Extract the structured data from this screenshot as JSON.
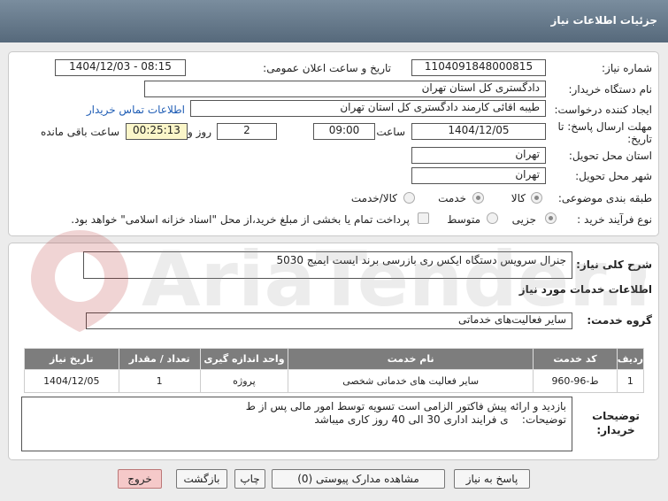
{
  "header": {
    "title": "جزئیات اطلاعات نیاز"
  },
  "form": {
    "need_number_label": "شماره نیاز:",
    "need_number": "1104091848000815",
    "announce_label": "تاریخ و ساعت اعلان عمومی:",
    "announce_value": "1404/12/03 - 08:15",
    "buyer_label": "نام دستگاه خریدار:",
    "buyer": "دادگستری کل استان تهران",
    "creator_label": "ایجاد کننده درخواست:",
    "creator": "طیبه اقائی کارمند دادگستری کل استان تهران",
    "contact_link": "اطلاعات تماس خریدار",
    "deadline_label": "مهلت ارسال پاسخ: تا تاریخ:",
    "deadline_date": "1404/12/05",
    "time_label": "ساعت",
    "deadline_time": "09:00",
    "days_value": "2",
    "days_label": "روز و",
    "remaining_time": "00:25:13",
    "remaining_label": "ساعت باقی مانده",
    "province_label": "استان محل تحویل:",
    "province": "تهران",
    "city_label": "شهر محل تحویل:",
    "city": "تهران",
    "category_label": "طبقه بندی موضوعی:",
    "category_options": [
      "کالا",
      "خدمت",
      "کالا/خدمت"
    ],
    "process_label": "نوع فرآیند خرید :",
    "process_options": [
      "جزیی",
      "متوسط"
    ],
    "payment_note": "پرداخت تمام یا بخشی از مبلغ خرید،از محل \"اسناد خزانه اسلامی\" خواهد بود."
  },
  "description": {
    "label": "شرح کلی نیاز:",
    "value": "جنرال سرویس دستگاه ایکس ری بازرسی برند ایست ایمیج 5030"
  },
  "services": {
    "section_title": "اطلاعات خدمات مورد نیاز",
    "group_label": "گروه خدمت:",
    "group_value": "سایر فعالیت‌های خدماتی",
    "columns": [
      "ردیف",
      "کد خدمت",
      "نام خدمت",
      "واحد اندازه گیری",
      "تعداد / مقدار",
      "تاریخ نیاز"
    ],
    "rows": [
      [
        "1",
        "ط-96-960",
        "سایر فعالیت های خدماتی شخصی",
        "پروژه",
        "1",
        "1404/12/05"
      ]
    ]
  },
  "notes": {
    "label": "توضیحات خریدار:",
    "line1": "بازدید و ارائه پیش فاکتور الزامی است تسویه توسط امور مالی پس از ط",
    "line2": "ی فرایند اداری 30 الی 40 روز کاری میباشد",
    "inline_label": "توضیحات:"
  },
  "buttons": {
    "reply": "پاسخ به نیاز",
    "attachments": "مشاهده مدارک پیوستی (0)",
    "print": "چاپ",
    "back": "بازگشت",
    "exit": "خروج"
  },
  "watermark": {
    "text": "AriaTender.net"
  }
}
